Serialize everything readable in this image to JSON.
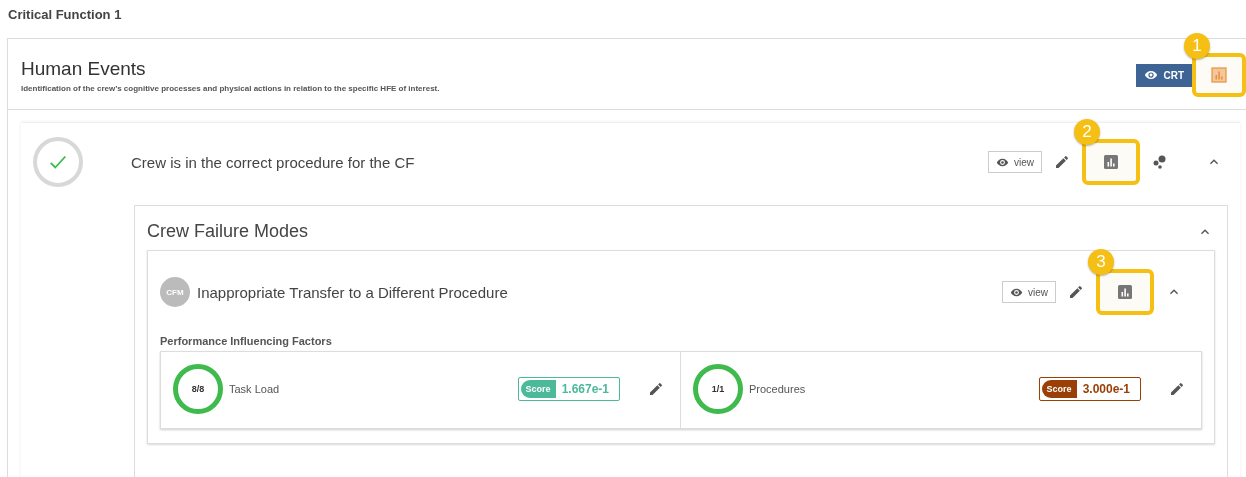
{
  "page_title": "Critical Function 1",
  "human_events": {
    "title": "Human Events",
    "description": "Identification of the crew’s cognitive processes and physical actions in relation to the specific HFE of interest.",
    "crt_button": {
      "label": "CRT"
    },
    "chart_button": {
      "callout": "1",
      "highlighted": true
    }
  },
  "hfe": {
    "title": "Crew is in the correct procedure for the CF",
    "completed": true,
    "view_button": {
      "label": "view"
    },
    "chart_button": {
      "callout": "2",
      "highlighted": true
    },
    "expanded": true
  },
  "crew_failure_modes": {
    "title": "Crew Failure Modes",
    "expanded": true,
    "items": [
      {
        "badge": "CFM",
        "title": "Inappropriate Transfer to a Different Procedure",
        "view_button": {
          "label": "view"
        },
        "chart_button": {
          "callout": "3",
          "highlighted": true
        },
        "pif_title": "Performance Influencing Factors",
        "factors": [
          {
            "count": "8/8",
            "name": "Task Load",
            "score_label": "Score",
            "score": "1.667e-1",
            "color": "#4bb99a"
          },
          {
            "count": "1/1",
            "name": "Procedures",
            "score_label": "Score",
            "score": "3.000e-1",
            "color": "#9a3f05"
          }
        ]
      }
    ]
  }
}
